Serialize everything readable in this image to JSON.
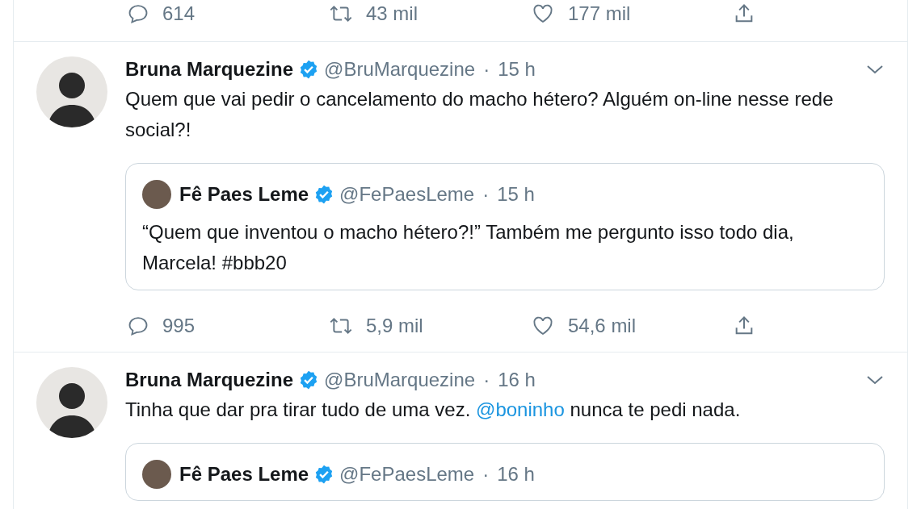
{
  "top_actions": {
    "replies": "614",
    "retweets": "43 mil",
    "likes": "177 mil"
  },
  "tweets": [
    {
      "name": "Bruna Marquezine",
      "verified": true,
      "handle": "@BruMarquezine",
      "separator": "·",
      "time": "15 h",
      "text": [
        {
          "kind": "plain",
          "text": "Quem que vai pedir o cancelamento do macho hétero? Alguém on-line nesse rede social?!"
        }
      ],
      "quote": {
        "name": "Fê Paes Leme",
        "verified": true,
        "handle": "@FePaesLeme",
        "separator": "·",
        "time": "15 h",
        "text": "“Quem que inventou o macho hétero?!” Também me pergunto isso todo dia, Marcela! #bbb20"
      },
      "actions": {
        "replies": "995",
        "retweets": "5,9 mil",
        "likes": "54,6 mil"
      }
    },
    {
      "name": "Bruna Marquezine",
      "verified": true,
      "handle": "@BruMarquezine",
      "separator": "·",
      "time": "16 h",
      "text": [
        {
          "kind": "plain",
          "text": "Tinha que dar pra tirar tudo de uma vez. "
        },
        {
          "kind": "mention",
          "text": "@boninho"
        },
        {
          "kind": "plain",
          "text": " nunca te pedi nada."
        }
      ],
      "quote": {
        "name": "Fê Paes Leme",
        "verified": true,
        "handle": "@FePaesLeme",
        "separator": "·",
        "time": "16 h"
      }
    }
  ]
}
